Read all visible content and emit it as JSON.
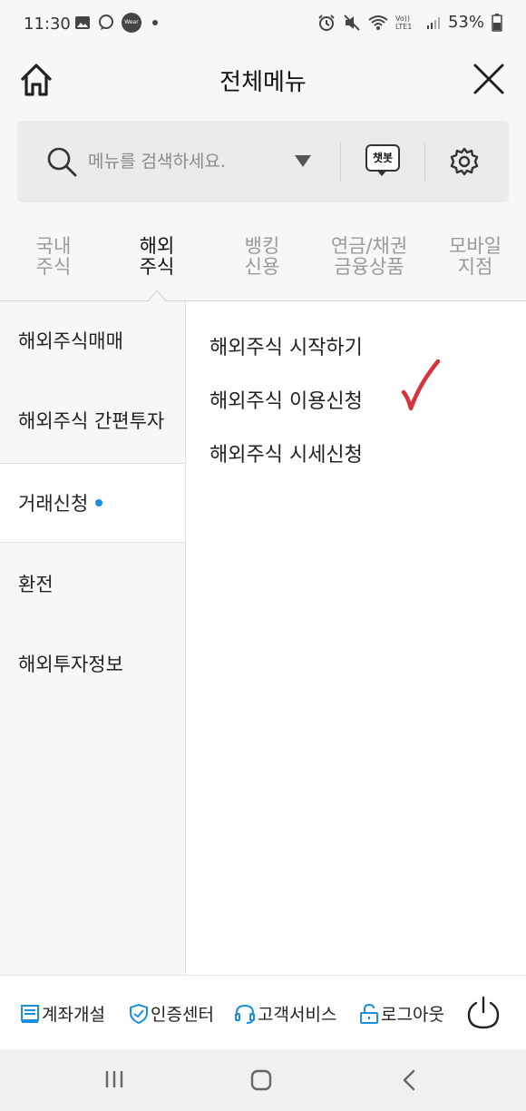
{
  "status_bar": {
    "time": "11:30",
    "left_icons": [
      "gallery-icon",
      "chat-icon",
      "wear-icon",
      "dot-icon"
    ],
    "wear_label": "Wear",
    "right_icons": [
      "alarm-icon",
      "mute-icon",
      "wifi-icon",
      "volte-lte-icon",
      "signal-icon",
      "battery-icon"
    ],
    "network_label": "Vo)) LTE1",
    "battery": "53%"
  },
  "header": {
    "title": "전체메뉴"
  },
  "search": {
    "placeholder": "메뉴를 검색하세요.",
    "chatbot_label": "챗봇"
  },
  "tabs": [
    {
      "line1": "국내",
      "line2": "주식",
      "active": false
    },
    {
      "line1": "해외",
      "line2": "주식",
      "active": true
    },
    {
      "line1": "뱅킹",
      "line2": "신용",
      "active": false
    },
    {
      "line1": "연금/채권",
      "line2": "금융상품",
      "active": false
    },
    {
      "line1": "모바일",
      "line2": "지점",
      "active": false
    }
  ],
  "left_menu": [
    {
      "label": "해외주식매매"
    },
    {
      "label": "해외주식 간편투자"
    },
    {
      "label": "거래신청",
      "selected": true,
      "dot": true
    },
    {
      "label": "환전"
    },
    {
      "label": "해외투자정보"
    }
  ],
  "submenu": [
    {
      "label": "해외주식 시작하기"
    },
    {
      "label": "해외주식 이용신청",
      "checked": true
    },
    {
      "label": "해외주식 시세신청"
    }
  ],
  "colors": {
    "accent_dot": "#1b8fe0",
    "annotation_check": "#d9323a",
    "bottom_icons": "#1b8fe0"
  },
  "bottom_bar": {
    "items": [
      {
        "label": "계좌개설",
        "icon": "document-icon"
      },
      {
        "label": "인증센터",
        "icon": "shield-check-icon"
      },
      {
        "label": "고객서비스",
        "icon": "headset-icon"
      },
      {
        "label": "로그아웃",
        "icon": "unlock-icon"
      }
    ],
    "power_icon": "power-icon"
  },
  "nav_bar": {
    "icons": [
      "recent-apps-icon",
      "home-icon",
      "back-icon"
    ]
  }
}
